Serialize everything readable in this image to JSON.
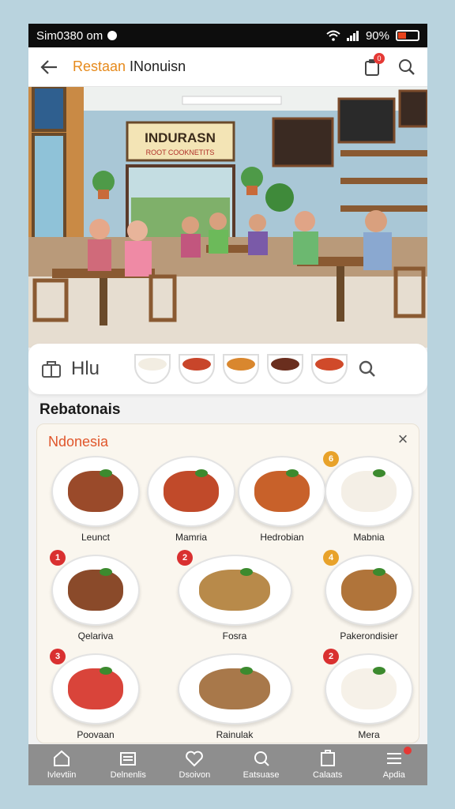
{
  "status_bar": {
    "time": "Sim0380 om",
    "right_text": "90%"
  },
  "header": {
    "title_accent": "Restaan",
    "title_rest": " INonuisn",
    "notification_count": "0"
  },
  "hero": {
    "sign_line1": "INDURASN",
    "sign_line2": "ROOT COOKNETITS"
  },
  "category_strip": {
    "label": "Hlu",
    "bowls": [
      "rice",
      "noodle",
      "nuggets",
      "beans",
      "vegetables"
    ]
  },
  "section": {
    "title": "Rebatonais"
  },
  "menu_card": {
    "title": "Ndonesia",
    "dishes": [
      {
        "name": "Leunct",
        "badge": "",
        "food_color": "#9a4a2a"
      },
      {
        "name": "Mamria",
        "badge": "",
        "food_color": "#c14a2a"
      },
      {
        "name": "Hedrobian",
        "badge": "",
        "food_color": "#c8612a"
      },
      {
        "name": "Mabnia",
        "badge": "6",
        "badge_color": "#e8a22a",
        "food_color": "#f4efe6"
      },
      {
        "name": "Qelariva",
        "badge": "1",
        "badge_color": "#d93030",
        "food_color": "#8a4a2a"
      },
      {
        "name": "Fosra",
        "badge": "2",
        "badge_color": "#d93030",
        "food_color": "#b88a4a"
      },
      {
        "name": "Pakerondisier",
        "badge": "4",
        "badge_color": "#e8a22a",
        "food_color": "#b0743a"
      },
      {
        "name": "Poovaan",
        "badge": "3",
        "badge_color": "#d93030",
        "food_color": "#d9443a"
      },
      {
        "name": "Rainulak",
        "badge": "",
        "food_color": "#a8784a"
      },
      {
        "name": "Mera",
        "badge": "2",
        "badge_color": "#d93030",
        "food_color": "#f6f1e8"
      }
    ]
  },
  "bottom_nav": [
    {
      "label": "Ivlevtiin",
      "icon": "home-icon"
    },
    {
      "label": "Delnenlis",
      "icon": "list-icon"
    },
    {
      "label": "Dsoivon",
      "icon": "heart-icon"
    },
    {
      "label": "Eatsuase",
      "icon": "search-icon"
    },
    {
      "label": "Calaats",
      "icon": "cart-icon"
    },
    {
      "label": "Apdia",
      "icon": "menu-icon"
    }
  ]
}
